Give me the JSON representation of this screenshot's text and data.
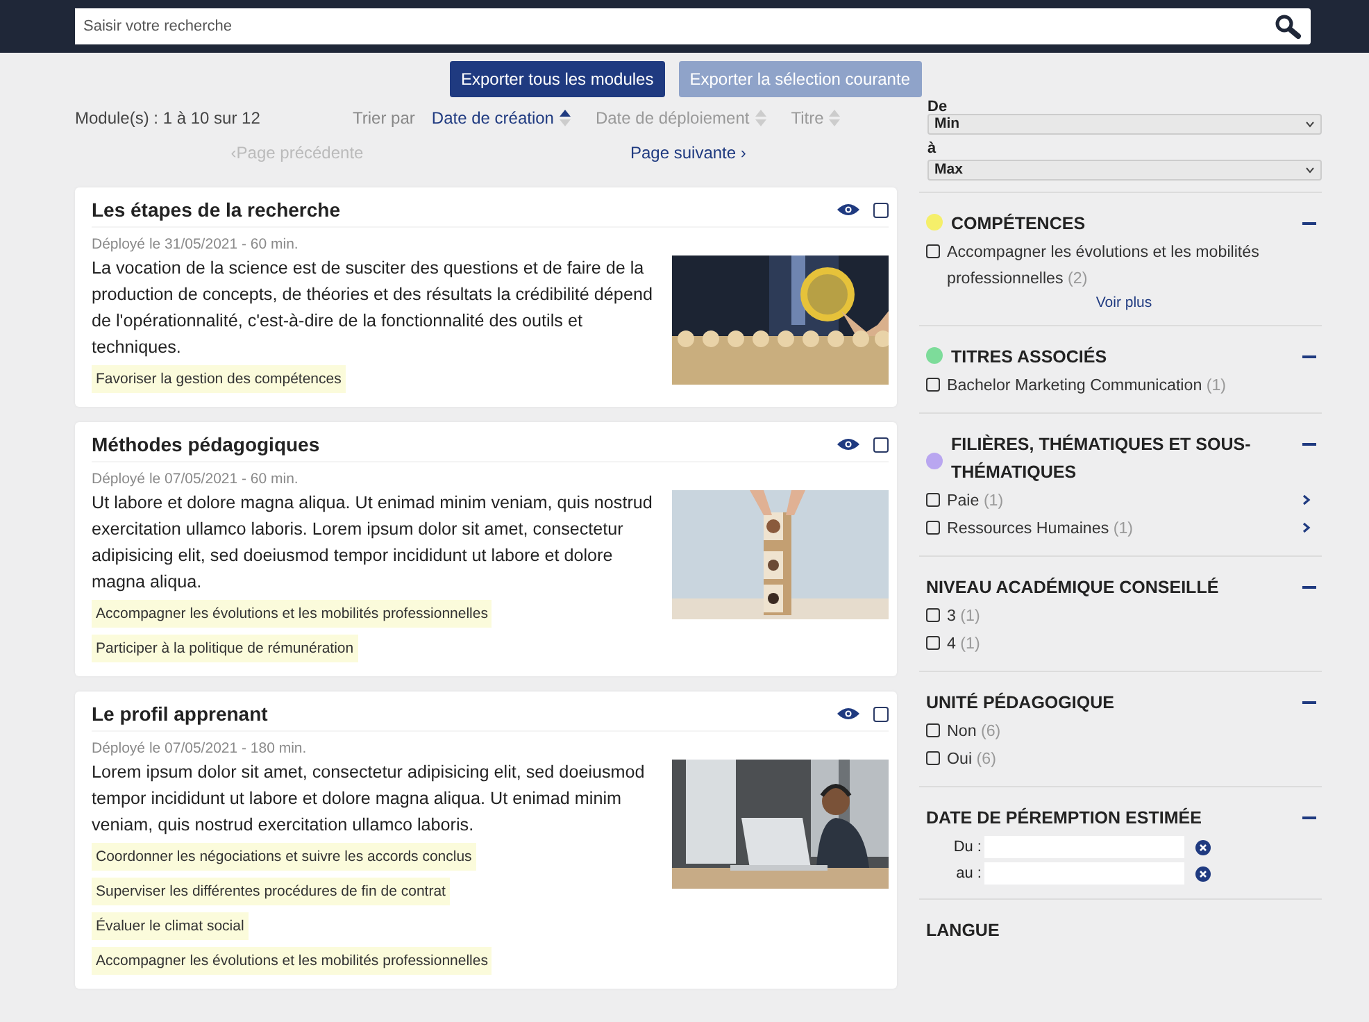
{
  "search": {
    "placeholder": "Saisir votre recherche"
  },
  "export_buttons": [
    {
      "label": "Exporter tous les modules",
      "disabled": false
    },
    {
      "label": "Exporter la sélection courante",
      "disabled": true
    }
  ],
  "result_count": "Module(s) : 1 à 10 sur 12",
  "sort": {
    "label": "Trier par",
    "options": [
      {
        "label": "Date de création",
        "selected": true
      },
      {
        "label": "Date de déploiement",
        "selected": false
      },
      {
        "label": "Titre",
        "selected": false
      }
    ]
  },
  "pagination": {
    "previous": {
      "label": "‹Page précédente",
      "disabled": true
    },
    "next": {
      "label": "Page suivante ›",
      "disabled": false
    }
  },
  "modules": [
    {
      "title": "Les étapes de la recherche",
      "meta": "Déployé le 31/05/2021 - 60 min.",
      "description": "La vocation de la science est de susciter des questions et de faire de la production de concepts, de théories et des résultats la crédibilité dépend de l'opérationnalité, c'est-à-dire de la fonctionnalité des outils et techniques.",
      "skills": [
        "Favoriser la gestion des compétences"
      ],
      "checked": false
    },
    {
      "title": "Méthodes pédagogiques",
      "meta": "Déployé le 07/05/2021 - 60 min.",
      "description": "Ut labore et dolore magna aliqua. Ut enimad minim veniam, quis nostrud exercitation ullamco laboris. Lorem ipsum dolor sit amet, consectetur adipisicing elit, sed doeiusmod tempor incididunt ut labore et dolore magna aliqua.",
      "skills": [
        "Accompagner les évolutions et les mobilités professionnelles",
        "Participer à la politique de rémunération"
      ],
      "checked": false
    },
    {
      "title": "Le profil apprenant",
      "meta": "Déployé le 07/05/2021 - 180 min.",
      "description": "Lorem ipsum dolor sit amet, consectetur adipisicing elit, sed doeiusmod tempor incididunt ut labore et dolore magna aliqua. Ut enimad minim veniam, quis nostrud exercitation ullamco laboris.",
      "skills": [
        "Coordonner les négociations et suivre les accords conclus",
        "Superviser les différentes procédures de fin de contrat",
        "Évaluer le climat social",
        "Accompagner les évolutions et les mobilités professionnelles"
      ],
      "checked": false
    }
  ],
  "filters": {
    "range": {
      "from_label": "De",
      "from_value": "Min",
      "to_label": "à",
      "to_value": "Max"
    },
    "sections": [
      {
        "kind": "checklist",
        "title": "COMPÉTENCES",
        "color": "#f5ef6a",
        "expanded": true,
        "items": [
          {
            "label": "Accompagner les évolutions et les mobilités professionnelles",
            "count": "(2)",
            "checked": false
          }
        ],
        "more_link": "Voir plus"
      },
      {
        "kind": "checklist",
        "title": "TITRES ASSOCIÉS",
        "color": "#7ddc9a",
        "expanded": true,
        "items": [
          {
            "label": "Bachelor Marketing Communication",
            "count": "(1)",
            "checked": false
          }
        ]
      },
      {
        "kind": "checklist",
        "title": "FILIÈRES, THÉMATIQUES ET SOUS-THÉMATIQUES",
        "color": "#b9a6f0",
        "expanded": true,
        "items": [
          {
            "label": "Paie",
            "count": "(1)",
            "checked": false,
            "has_children": true
          },
          {
            "label": "Ressources Humaines",
            "count": "(1)",
            "checked": false,
            "has_children": true
          }
        ]
      },
      {
        "kind": "checklist",
        "title": "NIVEAU ACADÉMIQUE CONSEILLÉ",
        "expanded": true,
        "items": [
          {
            "label": "3",
            "count": "(1)",
            "checked": false
          },
          {
            "label": "4",
            "count": "(1)",
            "checked": false
          }
        ]
      },
      {
        "kind": "checklist",
        "title": "UNITÉ PÉDAGOGIQUE",
        "expanded": true,
        "items": [
          {
            "label": "Non",
            "count": "(6)",
            "checked": false
          },
          {
            "label": "Oui",
            "count": "(6)",
            "checked": false
          }
        ]
      },
      {
        "kind": "dates",
        "title": "DATE DE PÉREMPTION ESTIMÉE",
        "expanded": true,
        "fields": [
          {
            "label": "Du :"
          },
          {
            "label": "au :"
          }
        ]
      },
      {
        "kind": "heading",
        "title": "LANGUE"
      }
    ]
  }
}
